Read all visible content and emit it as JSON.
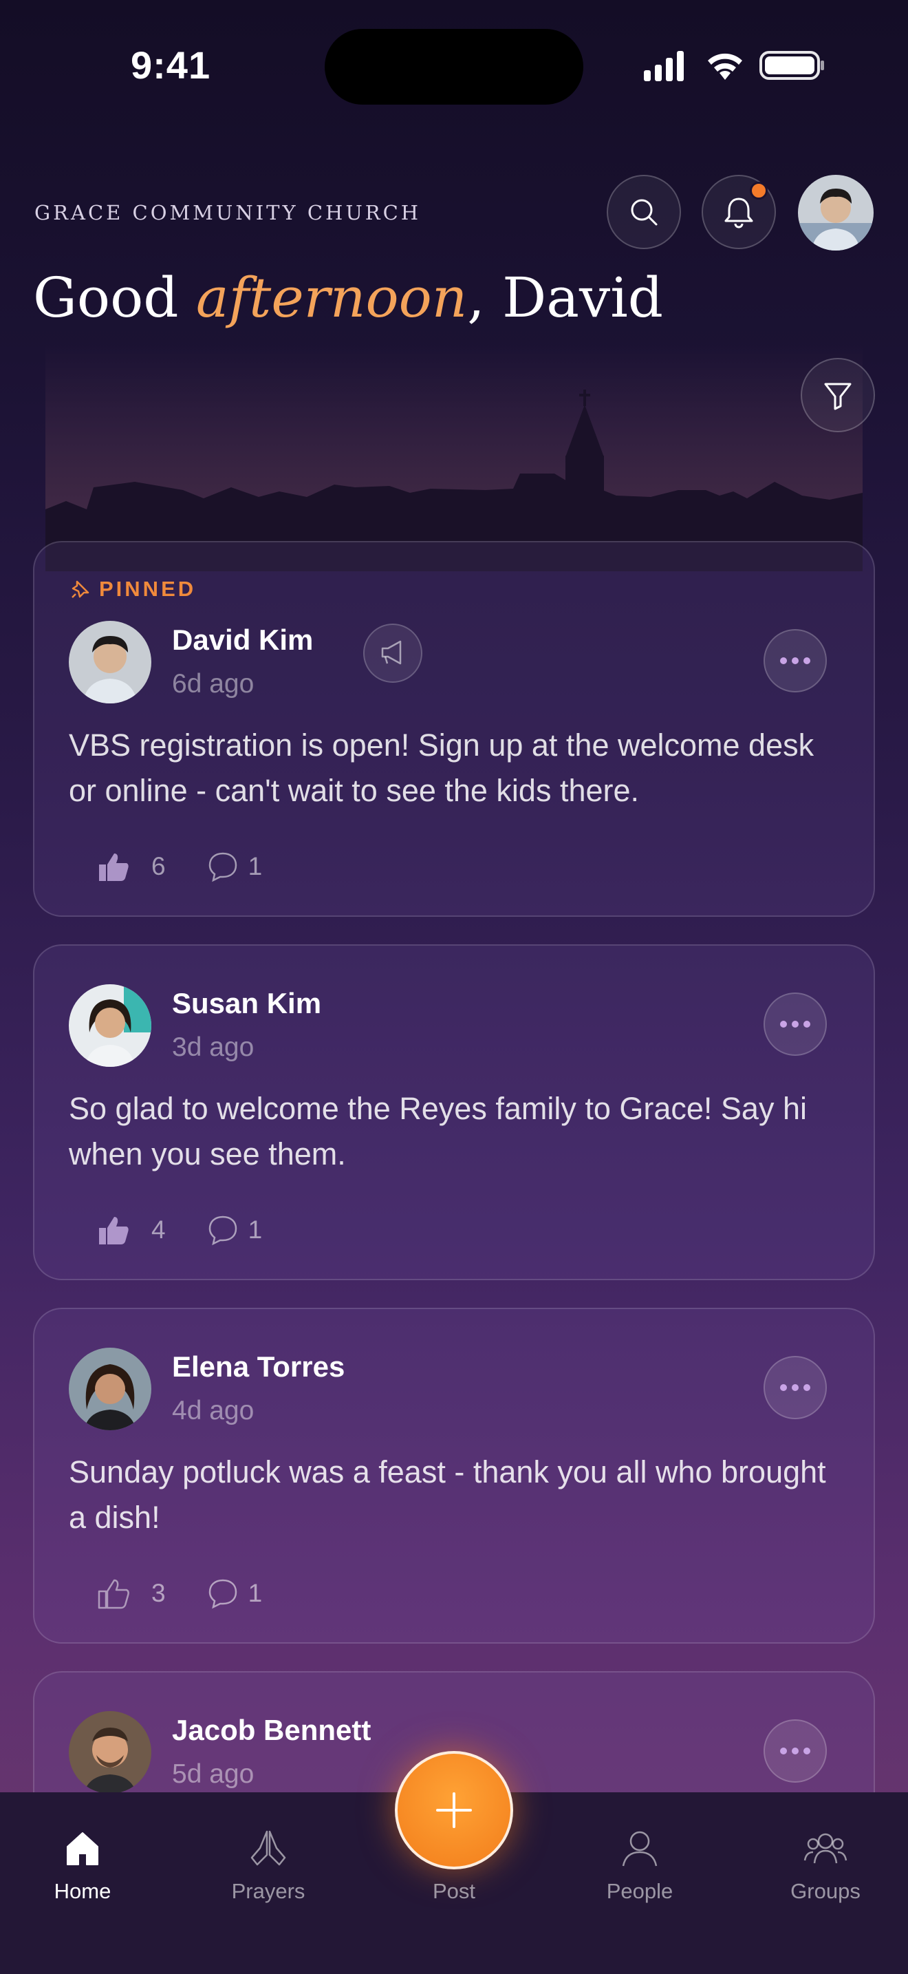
{
  "status_bar": {
    "time": "9:41"
  },
  "header": {
    "church_name": "GRACE COMMUNITY CHURCH",
    "greeting_prefix": "Good ",
    "greeting_emphasis": "afternoon",
    "greeting_suffix": ", David",
    "icons": [
      "search-icon",
      "bell-icon",
      "filter-icon"
    ],
    "has_notification": true
  },
  "colors": {
    "accent": "#f4a35a",
    "pinned": "#f08a3c",
    "fab": "#f27d1b"
  },
  "posts": [
    {
      "pinned_label": "PINNED",
      "author": "David Kim",
      "time": "6d ago",
      "body": "VBS registration is open! Sign up at the welcome desk or online - can't wait to see the kids there.",
      "likes": "6",
      "comments": "1",
      "liked": true,
      "announcement": true
    },
    {
      "author": "Susan Kim",
      "time": "3d ago",
      "body": "So glad to welcome the Reyes family to Grace! Say hi when you see them.",
      "likes": "4",
      "comments": "1",
      "liked": true
    },
    {
      "author": "Elena Torres",
      "time": "4d ago",
      "body": "Sunday potluck was a feast - thank you all who brought a dish!",
      "likes": "3",
      "comments": "1",
      "liked": false
    },
    {
      "author": "Jacob Bennett",
      "time": "5d ago"
    }
  ],
  "nav": {
    "home": "Home",
    "prayers": "Prayers",
    "post": "Post",
    "people": "People",
    "groups": "Groups",
    "active": "home"
  }
}
